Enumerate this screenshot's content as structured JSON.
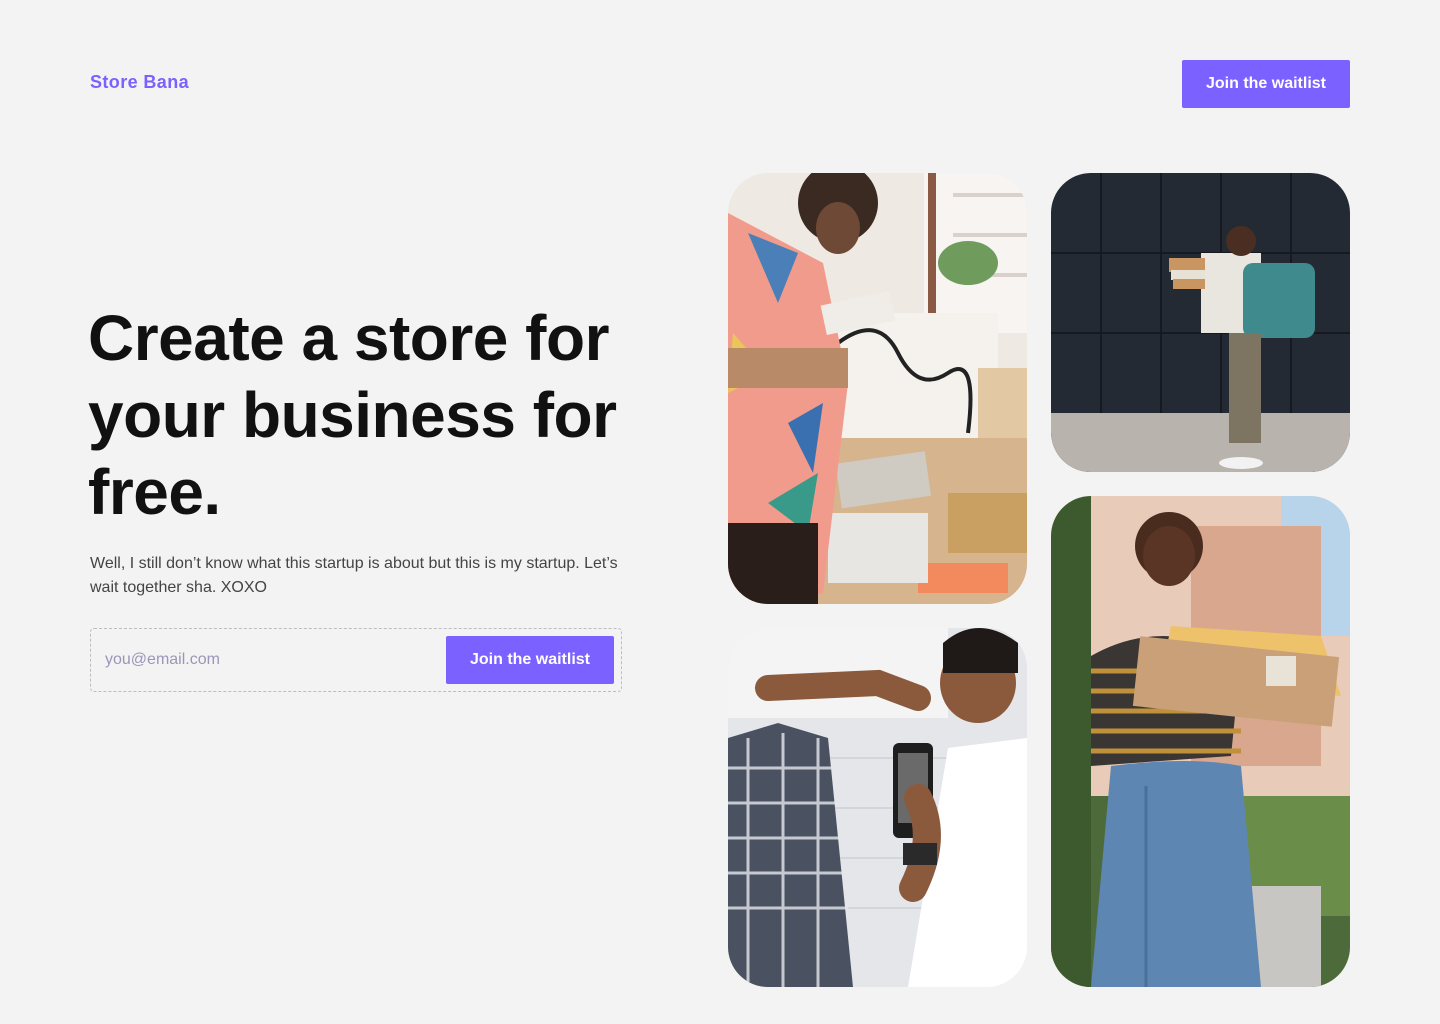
{
  "header": {
    "logo": "Store Bana",
    "cta_label": "Join the waitlist"
  },
  "hero": {
    "title": "Create a store for your business for free.",
    "subtitle": "Well, I still don’t know what this startup is about but this is my startup. Let’s wait together sha. XOXO",
    "email_placeholder": "you@email.com",
    "cta_label": "Join the waitlist"
  },
  "gallery": [
    {
      "name": "woman-sorting-artwork-photo"
    },
    {
      "name": "courier-delivering-boxes-photo"
    },
    {
      "name": "man-photographing-shirt-photo"
    },
    {
      "name": "smiling-woman-with-packages-photo"
    }
  ],
  "colors": {
    "accent": "#7b61ff",
    "background": "#f3f3f3",
    "text": "#111111"
  }
}
